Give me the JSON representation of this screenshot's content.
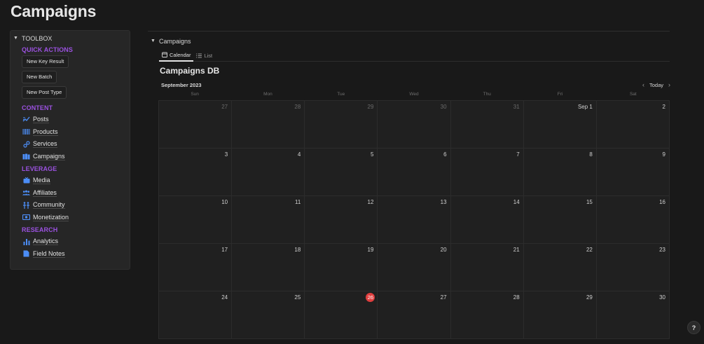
{
  "page": {
    "title": "Campaigns"
  },
  "toolbox": {
    "title": "TOOLBOX",
    "quick_actions_title": "QUICK ACTIONS",
    "quick_actions": [
      "New Key Result",
      "New Batch",
      "New Post Type"
    ],
    "content_title": "CONTENT",
    "content_items": [
      {
        "label": "Posts",
        "icon": "trend-icon"
      },
      {
        "label": "Products",
        "icon": "barcode-icon"
      },
      {
        "label": "Services",
        "icon": "link-icon"
      },
      {
        "label": "Campaigns",
        "icon": "book-icon"
      }
    ],
    "leverage_title": "LEVERAGE",
    "leverage_items": [
      {
        "label": "Media",
        "icon": "tv-icon"
      },
      {
        "label": "Affiliates",
        "icon": "people-icon"
      },
      {
        "label": "Community",
        "icon": "community-icon"
      },
      {
        "label": "Monetization",
        "icon": "money-icon"
      }
    ],
    "research_title": "RESEARCH",
    "research_items": [
      {
        "label": "Analytics",
        "icon": "bar-chart-icon"
      },
      {
        "label": "Field Notes",
        "icon": "document-icon"
      }
    ]
  },
  "database": {
    "toggle_label": "Campaigns",
    "tabs": [
      {
        "label": "Calendar",
        "active": true
      },
      {
        "label": "List",
        "active": false
      }
    ],
    "title": "Campaigns DB",
    "month": "September 2023",
    "today_label": "Today",
    "weekdays": [
      "Sun",
      "Mon",
      "Tue",
      "Wed",
      "Thu",
      "Fri",
      "Sat"
    ],
    "weeks": [
      [
        "27",
        "28",
        "29",
        "30",
        "31",
        "Sep 1",
        "2"
      ],
      [
        "3",
        "4",
        "5",
        "6",
        "7",
        "8",
        "9"
      ],
      [
        "10",
        "11",
        "12",
        "13",
        "14",
        "15",
        "16"
      ],
      [
        "17",
        "18",
        "19",
        "20",
        "21",
        "22",
        "23"
      ],
      [
        "24",
        "25",
        "26",
        "27",
        "28",
        "29",
        "30"
      ]
    ],
    "today_date": "26"
  },
  "help": {
    "label": "?"
  },
  "colors": {
    "accent": "#9b51e0",
    "icon": "#4c8df6",
    "today": "#e03e3e"
  }
}
